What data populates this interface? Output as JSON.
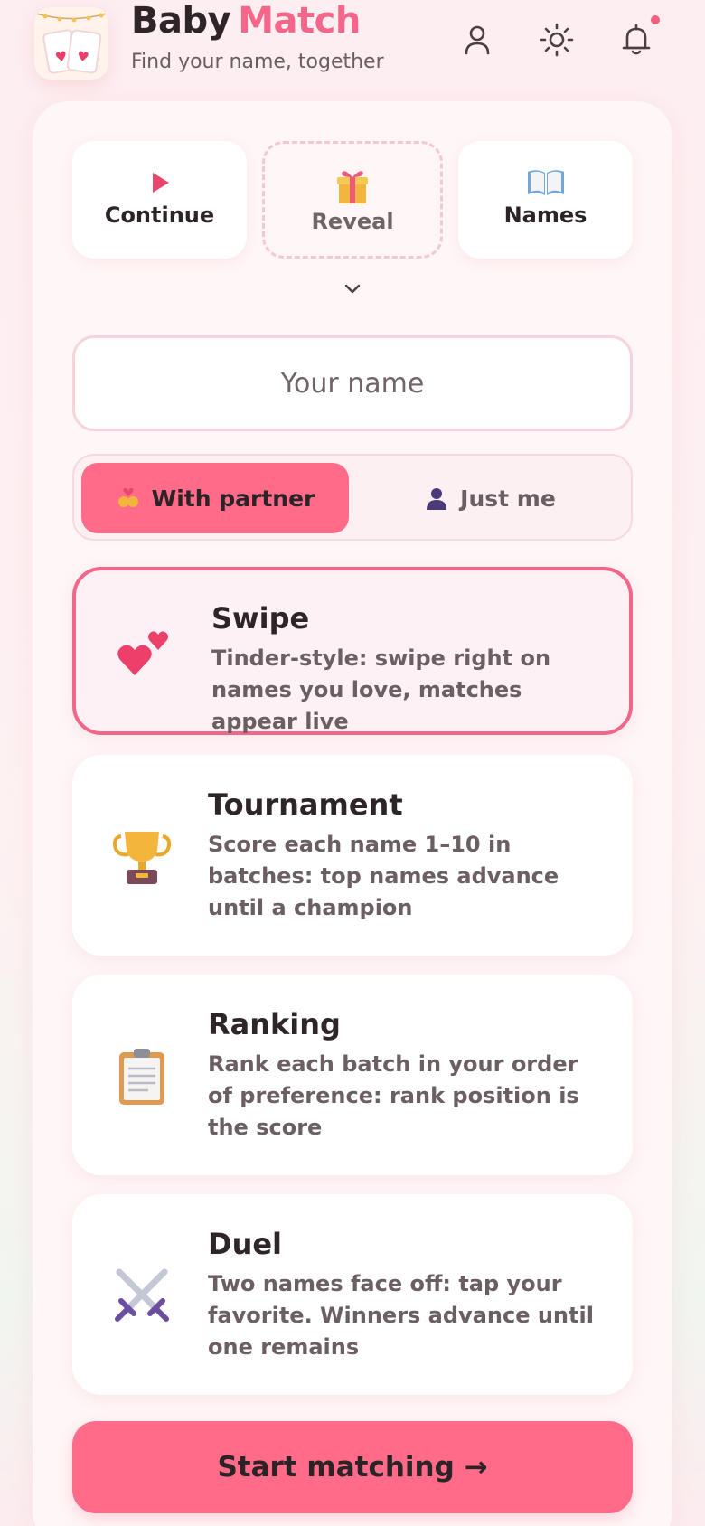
{
  "header": {
    "title_part1": "Baby",
    "title_part2": "Match",
    "subtitle": "Find your name, together",
    "icons": [
      "user-icon",
      "sun-icon",
      "bell-icon"
    ],
    "has_notification": true
  },
  "quick_actions": [
    {
      "label": "Continue",
      "icon": "play-icon"
    },
    {
      "label": "Reveal",
      "icon": "gift-icon"
    },
    {
      "label": "Names",
      "icon": "book-icon"
    }
  ],
  "name_input": {
    "placeholder": "Your name",
    "value": ""
  },
  "partner_toggle": {
    "options": [
      {
        "label": "With partner",
        "icon": "couple-icon",
        "selected": true
      },
      {
        "label": "Just me",
        "icon": "person-icon",
        "selected": false
      }
    ]
  },
  "modes": [
    {
      "title": "Swipe",
      "description": "Tinder-style: swipe right on names you love, matches appear live",
      "icon": "hearts-icon",
      "selected": true
    },
    {
      "title": "Tournament",
      "description": "Score each name 1–10 in batches: top names advance until a champion",
      "icon": "trophy-icon",
      "selected": false
    },
    {
      "title": "Ranking",
      "description": "Rank each batch in your order of preference: rank position is the score",
      "icon": "clipboard-icon",
      "selected": false
    },
    {
      "title": "Duel",
      "description": "Two names face off: tap your favorite. Winners advance until one remains",
      "icon": "crossed-swords-icon",
      "selected": false
    }
  ],
  "start_button": {
    "label": "Start matching →"
  },
  "colors": {
    "accent": "#ff6b88",
    "brand_pink": "#f5678a",
    "text_dark": "#2e2528",
    "muted": "#6b5f63"
  }
}
